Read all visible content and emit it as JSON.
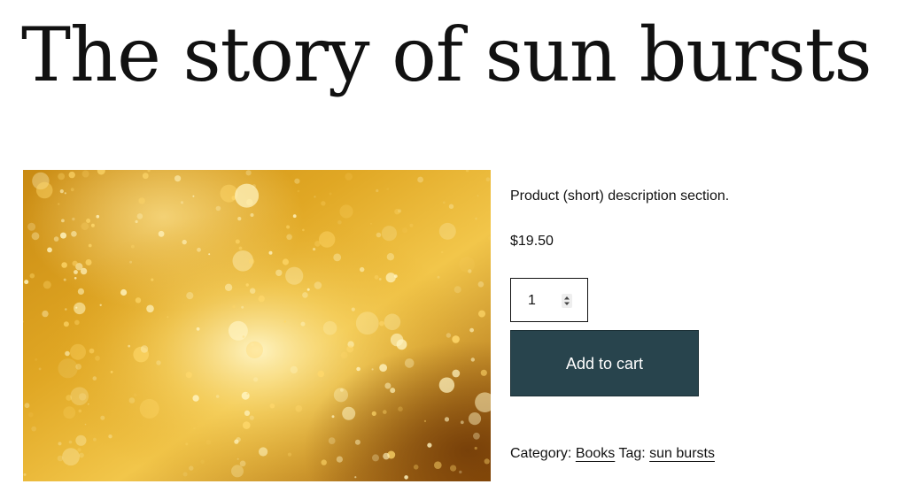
{
  "product": {
    "title": "The story of sun bursts",
    "short_description": "Product (short) description section.",
    "price": "$19.50",
    "quantity": "1",
    "add_to_cart_label": "Add to cart",
    "category_label": "Category:",
    "category": "Books",
    "tag_label": "Tag:",
    "tag": "sun bursts"
  },
  "colors": {
    "button_bg": "#28444d",
    "button_text": "#ffffff",
    "image_gold": "#d9a21e"
  },
  "icons": {
    "quantity_spinner": "spinner-arrows-icon"
  }
}
